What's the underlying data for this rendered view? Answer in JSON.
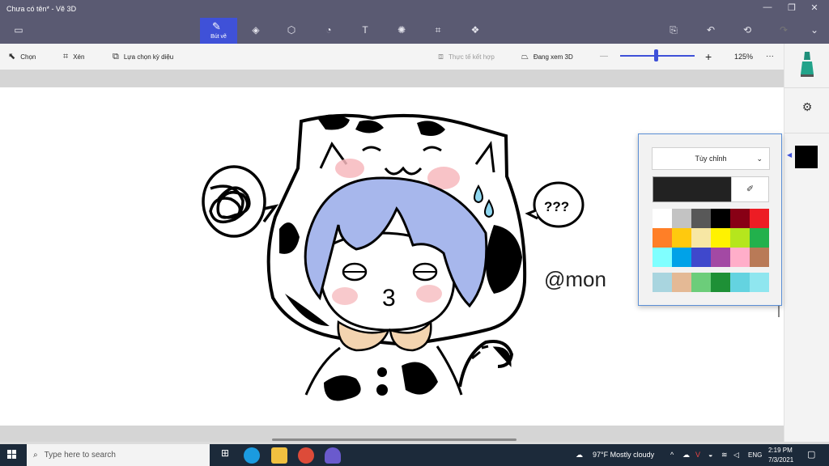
{
  "window": {
    "title": "Chưa có tên* - Vẽ 3D"
  },
  "ribbon": {
    "active_tab_label": "Bút vẽ",
    "tabs": [
      {
        "icon": "brush-icon"
      },
      {
        "icon": "2d-shapes-icon"
      },
      {
        "icon": "3d-shapes-icon"
      },
      {
        "icon": "stickers-icon"
      },
      {
        "icon": "text-icon"
      },
      {
        "icon": "effects-icon"
      },
      {
        "icon": "canvas-icon"
      },
      {
        "icon": "3d-library-icon"
      }
    ]
  },
  "toolbar": {
    "select_label": "Chọn",
    "crop_label": "Xén",
    "magic_select_label": "Lựa chọn kỳ diệu",
    "mixed_reality_label": "Thực tế kết hợp",
    "view_3d_label": "Đang xem 3D",
    "zoom_minus": "—",
    "zoom_plus": "+",
    "zoom_level": "125%",
    "zoom_fraction": 0.48,
    "more": "···"
  },
  "canvas": {
    "watermark_text": "@mon",
    "speech_text": "???"
  },
  "color_picker": {
    "mode_label": "Tùy chỉnh",
    "current_color": "#222222",
    "palette": [
      "#ffffff",
      "#c3c3c3",
      "#585858",
      "#000000",
      "#880015",
      "#ed1c24",
      "#ff7f27",
      "#ffc90e",
      "#f7e7a4",
      "#fff200",
      "#b5e61d",
      "#22b14c",
      "#80ffff",
      "#00a2e8",
      "#3f48cc",
      "#a349a4",
      "#ffaec9",
      "#b97a57"
    ],
    "custom_row": [
      "#a9d5df",
      "#e4b995",
      "#6ccd7a",
      "#1e9036",
      "#64d3e0",
      "#8fe6ef"
    ]
  },
  "side_panel": {
    "selected_color": "#000000"
  },
  "taskbar": {
    "search_placeholder": "Type here to search",
    "weather": "97°F  Mostly cloudy",
    "language": "ENG",
    "time": "2:19 PM",
    "date": "7/3/2021"
  },
  "colors": {
    "ribbon_bg": "#5a5a72",
    "accent": "#3f51d8",
    "taskbar_bg": "#1c2a3a"
  }
}
